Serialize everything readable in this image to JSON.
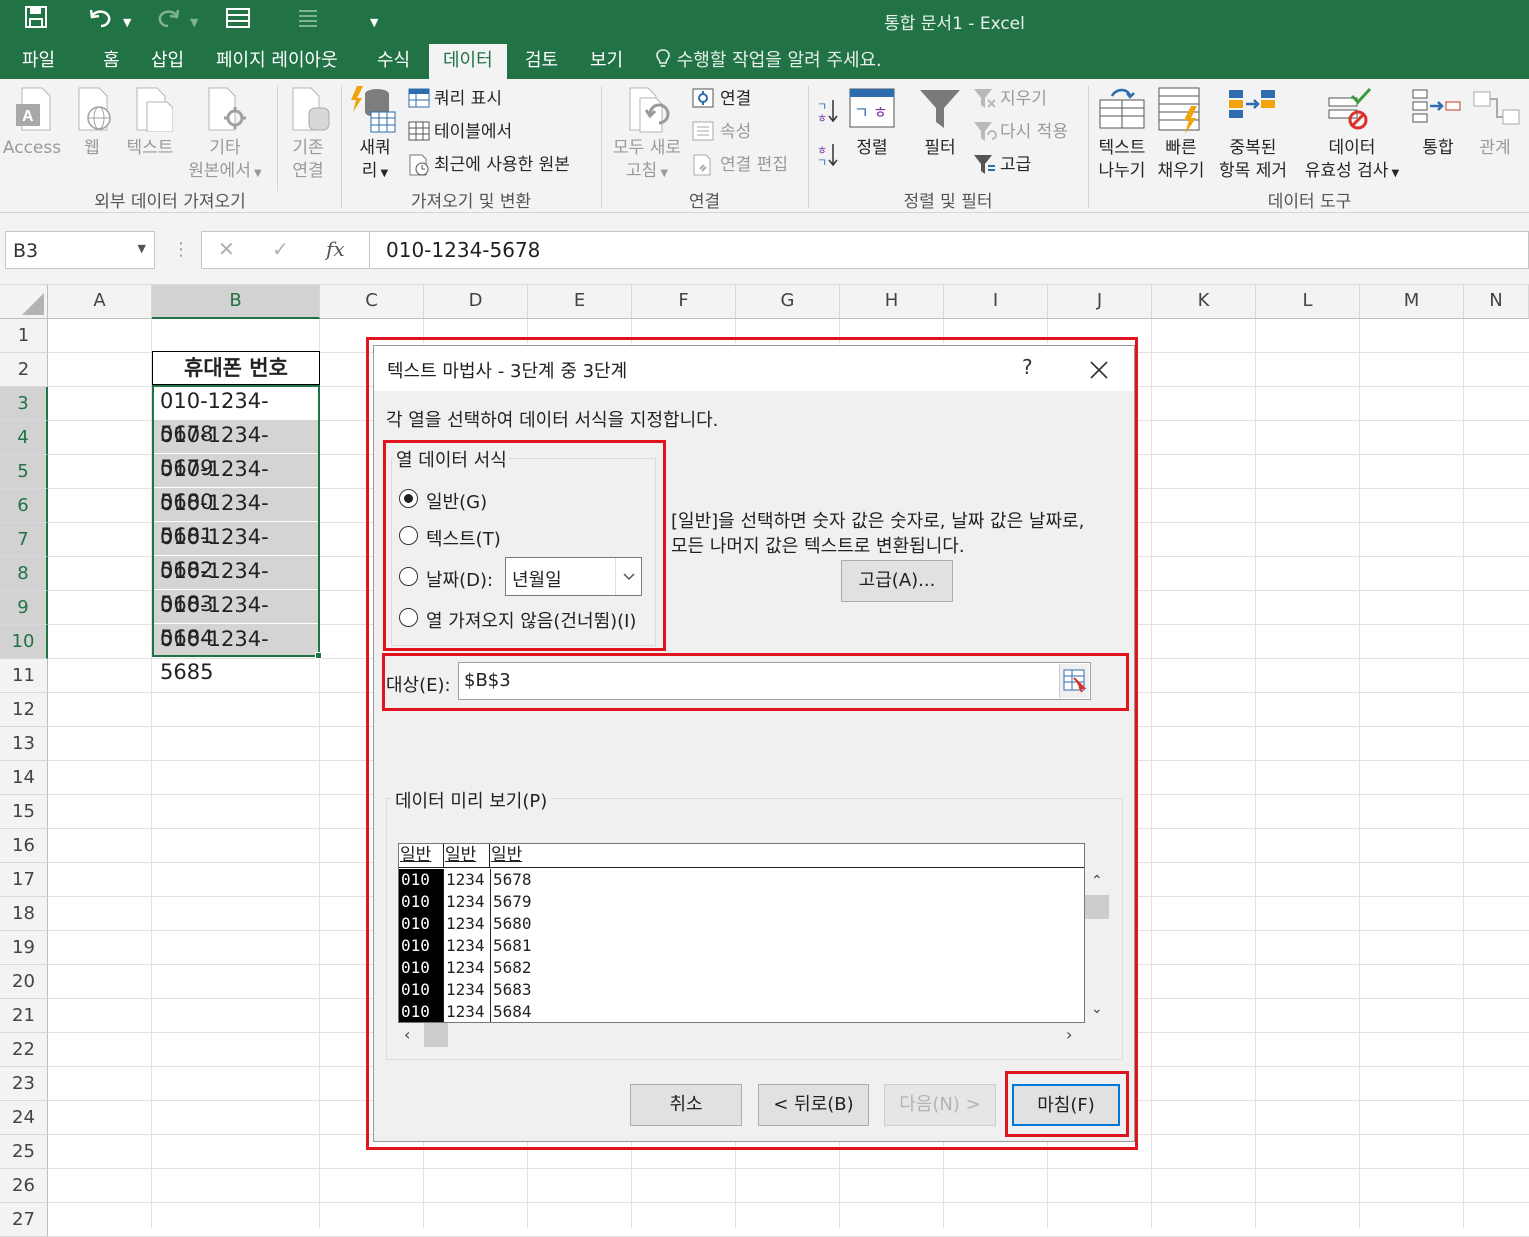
{
  "app": {
    "title": "통합 문서1 - Excel"
  },
  "quick_access": {
    "save_icon": "save-icon",
    "undo_icon": "undo-icon",
    "redo_icon": "redo-icon",
    "form_icon": "form-icon",
    "customize_icon": "customize-icon"
  },
  "menu": {
    "items": [
      "파일",
      "홈",
      "삽입",
      "페이지 레이아웃",
      "수식",
      "데이터",
      "검토",
      "보기"
    ],
    "active": "데이터",
    "tell_me": "수행할 작업을 알려 주세요."
  },
  "ribbon": {
    "access": "Access",
    "web": "웹",
    "text": "텍스트",
    "other_line1": "기타",
    "other_line2": "원본에서",
    "existing_line1": "기존",
    "existing_line2": "연결",
    "new_query_line1": "새쿼",
    "new_query_line2": "리",
    "show_query": "쿼리 표시",
    "from_table": "테이블에서",
    "recent_sources": "최근에 사용한 원본",
    "refresh_line1": "모두 새로",
    "refresh_line2": "고침",
    "connections": "연결",
    "properties": "속성",
    "edit_links": "연결 편집",
    "sort": "정렬",
    "filter": "필터",
    "clear": "지우기",
    "reapply": "다시 적용",
    "advanced": "고급",
    "text_to_col_line1": "텍스트",
    "text_to_col_line2": "나누기",
    "flash_fill_line1": "빠른",
    "flash_fill_line2": "채우기",
    "remove_dup_line1": "중복된",
    "remove_dup_line2": "항목 제거",
    "validation_line1": "데이터",
    "validation_line2": "유효성 검사",
    "consolidate": "통합",
    "relationships": "관계",
    "groups": {
      "external": "외부 데이터 가져오기",
      "get_transform": "가져오기 및 변환",
      "connections": "연결",
      "sort_filter": "정렬 및 필터",
      "data_tools": "데이터 도구"
    }
  },
  "formula_bar": {
    "name_box": "B3",
    "cancel": "✕",
    "enter": "✓",
    "fx": "fx",
    "value": "010-1234-5678"
  },
  "sheet": {
    "columns": [
      "A",
      "B",
      "C",
      "D",
      "E",
      "F",
      "G",
      "H",
      "I",
      "J",
      "K",
      "L",
      "M",
      "N"
    ],
    "rows": [
      "1",
      "2",
      "3",
      "4",
      "5",
      "6",
      "7",
      "8",
      "9",
      "10",
      "11",
      "12",
      "13",
      "14",
      "15",
      "16",
      "17",
      "18",
      "19",
      "20",
      "21",
      "22",
      "23",
      "24",
      "25",
      "26",
      "27"
    ],
    "header_cell": "휴대폰 번호",
    "phone_numbers": [
      "010-1234-5678",
      "010-1234-5679",
      "010-1234-5680",
      "010-1234-5681",
      "010-1234-5682",
      "010-1234-5683",
      "010-1234-5684",
      "010-1234-5685"
    ]
  },
  "dialog": {
    "title": "텍스트 마법사 - 3단계 중 3단계",
    "help": "?",
    "close": "✕",
    "instruction": "각 열을 선택하여 데이터 서식을 지정합니다.",
    "format_group": "열 데이터 서식",
    "opt_general": "일반(G)",
    "opt_text": "텍스트(T)",
    "opt_date": "날짜(D):",
    "date_format": "년월일",
    "opt_skip": "열 가져오지 않음(건너뜀)(I)",
    "selected_option": "일반(G)",
    "note_line1": "[일반]을 선택하면 숫자 값은 숫자로, 날짜 값은 날짜로,",
    "note_line2": "모든 나머지 값은 텍스트로 변환됩니다.",
    "advanced_btn": "고급(A)...",
    "dest_label": "대상(E):",
    "dest_value": "$B$3",
    "preview_label": "데이터 미리 보기(P)",
    "preview_headers": [
      "일반",
      "일반",
      "일반"
    ],
    "preview_rows": [
      [
        "010",
        "1234",
        "5678"
      ],
      [
        "010",
        "1234",
        "5679"
      ],
      [
        "010",
        "1234",
        "5680"
      ],
      [
        "010",
        "1234",
        "5681"
      ],
      [
        "010",
        "1234",
        "5682"
      ],
      [
        "010",
        "1234",
        "5683"
      ],
      [
        "010",
        "1234",
        "5684"
      ]
    ],
    "btn_cancel": "취소",
    "btn_back": "< 뒤로(B)",
    "btn_next": "다음(N) >",
    "btn_finish": "마침(F)"
  },
  "colors": {
    "excel_green": "#217346",
    "highlight_red": "#e0141e",
    "selection_gray": "#d4d4d4",
    "focus_blue": "#0078d7"
  }
}
